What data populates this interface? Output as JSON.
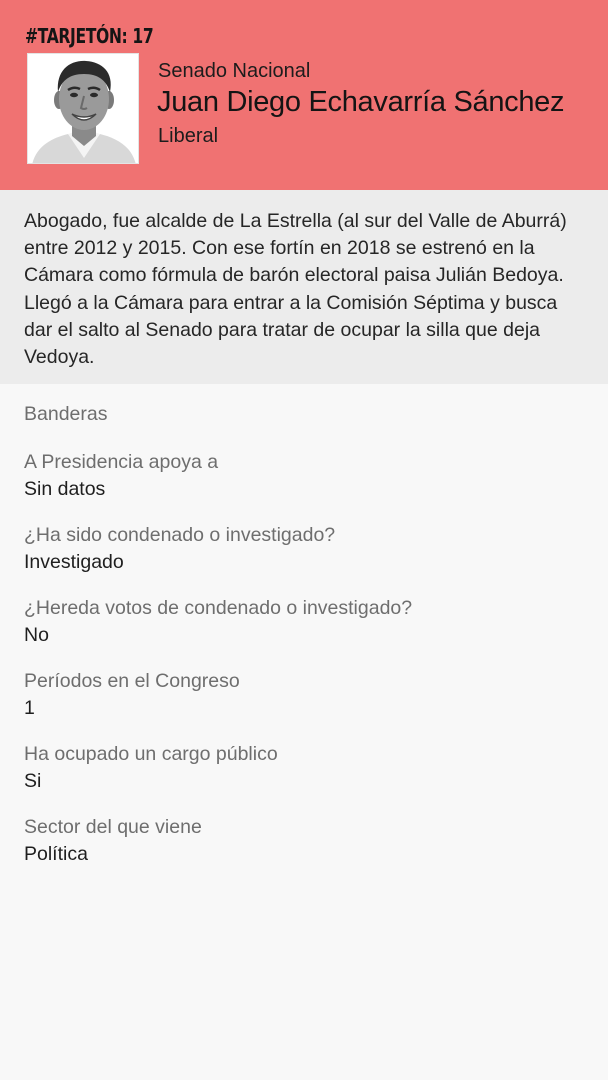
{
  "header": {
    "tag": "#TARJETÓN: 17",
    "chamber": "Senado Nacional",
    "candidate_name": "Juan Diego Echavarría Sánchez",
    "party": "Liberal",
    "photo_icon": "candidate-portrait",
    "background_color": "#f07272"
  },
  "bio": {
    "text": "Abogado, fue alcalde de La Estrella (al sur del Valle de Aburrá) entre 2012 y 2015. Con ese fortín en 2018 se estrenó en la Cámara como fórmula de barón electoral paisa Julián Bedoya. Llegó a la Cámara para entrar a la Comisión Séptima y busca dar el salto al Senado para tratar de ocupar la silla que deja Vedoya."
  },
  "flags": {
    "title": "Banderas",
    "items": [
      {
        "label": "A Presidencia apoya a",
        "value": "Sin datos"
      },
      {
        "label": "¿Ha sido condenado o investigado?",
        "value": "Investigado"
      },
      {
        "label": "¿Hereda votos de condenado o investigado?",
        "value": "No"
      },
      {
        "label": "Períodos en el Congreso",
        "value": "1"
      },
      {
        "label": "Ha ocupado un cargo público",
        "value": "Si"
      },
      {
        "label": "Sector del que viene",
        "value": "Política"
      }
    ]
  }
}
